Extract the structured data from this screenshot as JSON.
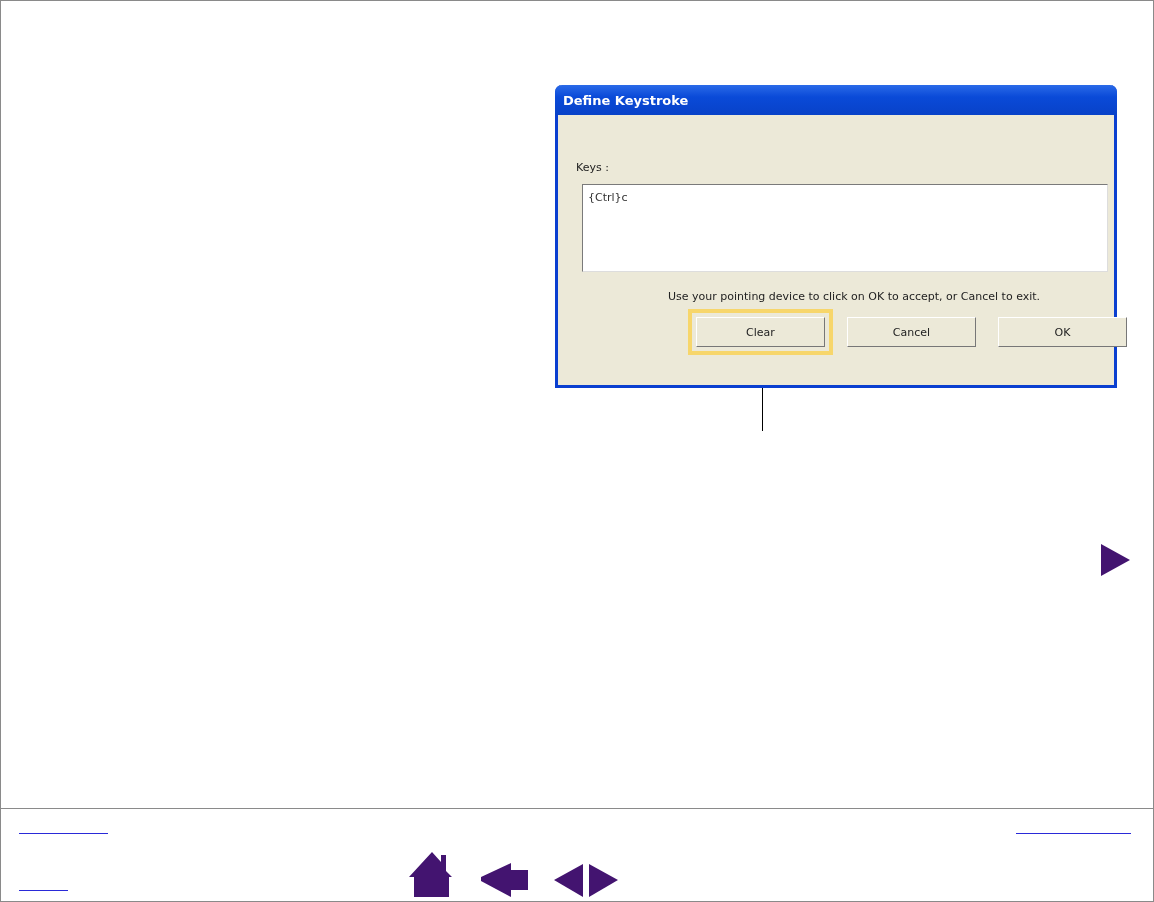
{
  "dialog": {
    "title": "Define Keystroke",
    "keys_label": "Keys :",
    "keys_value": "{Ctrl}c",
    "instruction": "Use your pointing device to click on OK to accept, or Cancel to exit.",
    "buttons": [
      {
        "label": "Clear",
        "highlighted": true
      },
      {
        "label": "Cancel",
        "highlighted": false
      },
      {
        "label": "OK",
        "highlighted": false
      }
    ]
  }
}
